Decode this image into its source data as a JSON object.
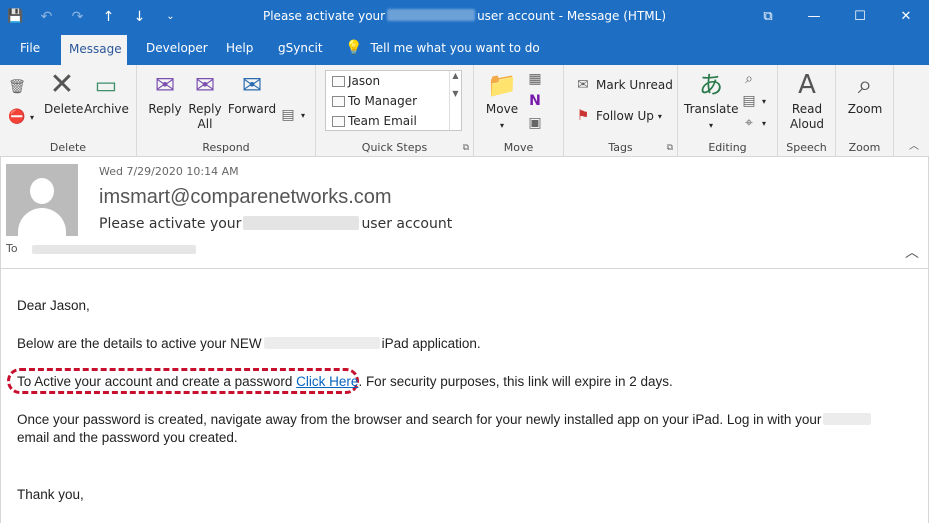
{
  "window": {
    "title_prefix": "Please activate your",
    "title_suffix": "user account - Message (HTML)",
    "controls": {
      "restore": "⧉",
      "minimize": "—",
      "maximize": "☐",
      "close": "✕"
    }
  },
  "qat": {
    "save": "💾",
    "undo": "↶",
    "redo": "↷",
    "up": "↑",
    "down": "↓",
    "more": "⌄"
  },
  "tabs": [
    "File",
    "Message",
    "Developer",
    "Help",
    "gSyncit"
  ],
  "tell_me": "Tell me what you want to do",
  "ribbon": {
    "delete_group": {
      "label": "Delete",
      "delete": "Delete",
      "archive": "Archive"
    },
    "respond_group": {
      "label": "Respond",
      "reply": "Reply",
      "reply_all_1": "Reply",
      "reply_all_2": "All",
      "forward": "Forward"
    },
    "quick_steps": {
      "label": "Quick Steps",
      "items": [
        "Jason",
        "To Manager",
        "Team Email"
      ]
    },
    "move_group": {
      "label": "Move",
      "move": "Move"
    },
    "tags_group": {
      "label": "Tags",
      "mark_unread": "Mark Unread",
      "follow_up": "Follow Up"
    },
    "editing_group": {
      "label": "Editing",
      "translate": "Translate"
    },
    "speech_group": {
      "label": "Speech",
      "read_1": "Read",
      "read_2": "Aloud"
    },
    "zoom_group": {
      "label": "Zoom",
      "zoom": "Zoom"
    }
  },
  "message": {
    "date": "Wed 7/29/2020 10:14 AM",
    "from": "imsmart@comparenetworks.com",
    "subject_prefix": "Please activate your",
    "subject_suffix": "user account",
    "to_label": "To"
  },
  "body": {
    "greeting": "Dear Jason,",
    "line1_prefix": "Below are the details to active your NEW",
    "line1_suffix": "iPad application.",
    "line2_prefix": "To Active your account and create a password",
    "link": "Click Here",
    "line2_suffix": ". For security purposes, this link will expire in 2 days.",
    "line3a": "Once your password is created, navigate away from the browser and search for your newly installed app on your iPad. Log in with your",
    "line3b": "email and the password you created.",
    "closing": "Thank you,"
  }
}
